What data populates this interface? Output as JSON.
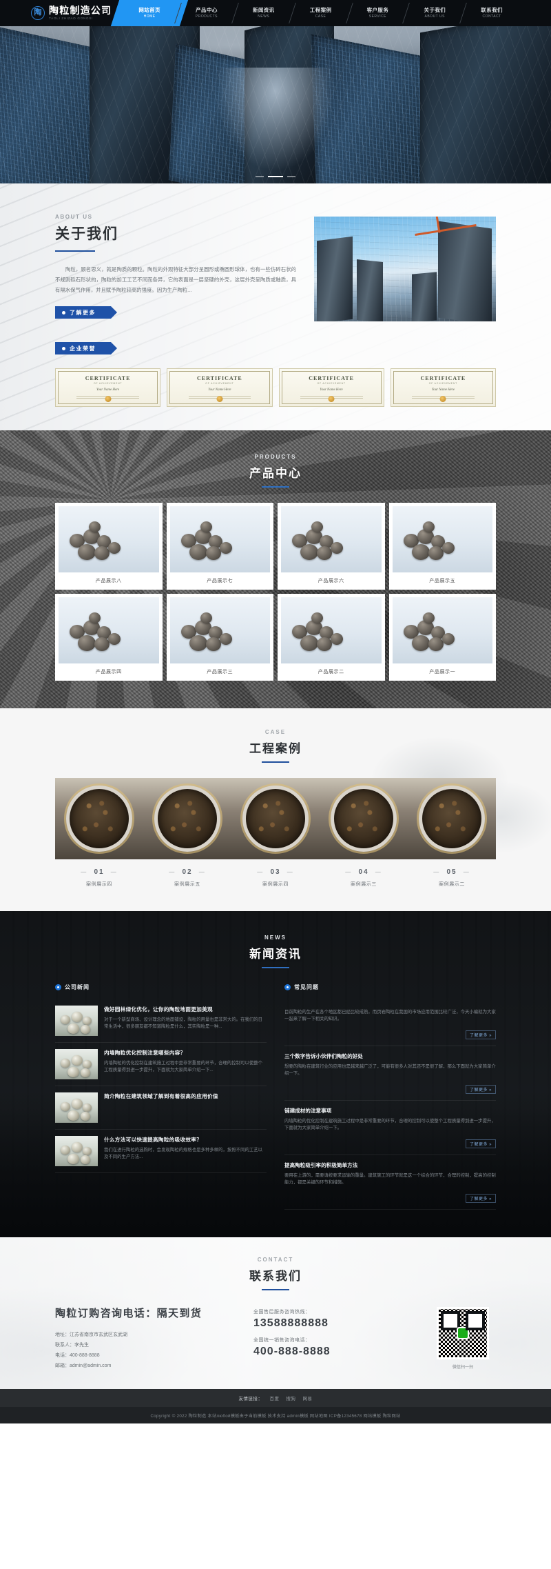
{
  "site": {
    "logo_char": "陶",
    "name_cn": "陶粒制造公司",
    "name_en": "TAOLI ZHIZAO GONGSI"
  },
  "nav": [
    {
      "cn": "网站首页",
      "en": "HOME",
      "active": true
    },
    {
      "cn": "产品中心",
      "en": "PRODUCTS",
      "active": false
    },
    {
      "cn": "新闻资讯",
      "en": "NEWS",
      "active": false
    },
    {
      "cn": "工程案例",
      "en": "CASE",
      "active": false
    },
    {
      "cn": "客户服务",
      "en": "SERVICE",
      "active": false
    },
    {
      "cn": "关于我们",
      "en": "ABOUT US",
      "active": false
    },
    {
      "cn": "联系我们",
      "en": "CONTACT",
      "active": false
    }
  ],
  "hero": {
    "slides": 3,
    "active_slide": 1
  },
  "about": {
    "eyebrow": "ABOUT US",
    "title": "关于我们",
    "paragraph": "陶粒，顾名思义，就是陶质的颗粒。陶粒的外观特征大部分呈圆形或椭圆形球体，也有一些仿碎石状的不规则砾石形状的，陶粒的加工工艺不同而各异，它的表面是一层坚硬的外壳，这层外壳呈陶质或釉质，具有隔水保气作用，并且赋予陶粒较高的强度。因为生产陶粒...",
    "more_button": "了解更多",
    "honor_label": "企业荣誉",
    "certificates": [
      {
        "title": "CERTIFICATE",
        "subtitle": "OF ACHIEVEMENT",
        "name": "Your Name Here"
      },
      {
        "title": "CERTIFICATE",
        "subtitle": "OF ACHIEVEMENT",
        "name": "Your Name Here"
      },
      {
        "title": "CERTIFICATE",
        "subtitle": "OF ACHIEVEMENT",
        "name": "Your Name Here"
      },
      {
        "title": "CERTIFICATE",
        "subtitle": "OF ACHIEVEMENT",
        "name": "Your Name Here"
      }
    ]
  },
  "products": {
    "eyebrow": "PRODUCTS",
    "title": "产品中心",
    "items": [
      {
        "caption": "产品展示八"
      },
      {
        "caption": "产品展示七"
      },
      {
        "caption": "产品展示六"
      },
      {
        "caption": "产品展示五"
      },
      {
        "caption": "产品展示四"
      },
      {
        "caption": "产品展示三"
      },
      {
        "caption": "产品展示二"
      },
      {
        "caption": "产品展示一"
      }
    ]
  },
  "cases": {
    "eyebrow": "CASE",
    "title": "工程案例",
    "items": [
      {
        "no": "01",
        "name": "案例展示四"
      },
      {
        "no": "02",
        "name": "案例展示五"
      },
      {
        "no": "03",
        "name": "案例展示四"
      },
      {
        "no": "04",
        "name": "案例展示三"
      },
      {
        "no": "05",
        "name": "案例展示二"
      }
    ]
  },
  "news": {
    "eyebrow": "NEWS",
    "title": "新闻资讯",
    "left_tab": "公司新闻",
    "right_tab": "常见问题",
    "more_label": "了解更多 »",
    "left_items": [
      {
        "title": "做好园林绿化优化，让你的陶粒地面更加美观",
        "desc": "对于一个新型商场、设计理念的地面铺设，陶粒的用量也是非常大的。在我们的日常生活中，很多朋友都不知道陶粒是什么，其实陶粒是一种..."
      },
      {
        "title": "内墙陶粒优化控制注意哪些内容？",
        "desc": "内墙陶粒的优化控制在建筑施工过程中是非常重要的环节，合理的控制可以使整个工程质量得到进一步提升，下面就为大家简单介绍一下..."
      },
      {
        "title": "简介陶粒在建筑领域了解到有着很高的应用价值"
      },
      {
        "title": "什么方法可以快速提高陶粒的吸收效率？",
        "desc": "我们在进行陶粒的选购时，会发现陶粒的规格也是多种多样的，按照不同的工艺以及不同的生产方法..."
      }
    ],
    "right_items": [
      {
        "title": "目前陶粒的生产在各个地区都已经比较成熟，而页岩陶粒在我国的市场应用范围比较广泛",
        "desc": "目前陶粒的生产在各个地区都已经比较成熟，而页岩陶粒在我国的市场应用范围比较广泛，今天小编就为大家一起来了解一下相关的知识。"
      },
      {
        "title": "三个数字告诉小伙伴们陶粒的好处",
        "desc": "想要的陶粒在建筑行业的应用也是越来越广泛了，可能有很多人对其还不是很了解，那么下面就为大家简单介绍一下。"
      },
      {
        "title": "铺建成材的注意事项",
        "desc": "内墙陶粒的优化控制在建筑施工过程中是非常重要的环节，合理的控制可以使整个工程质量得到进一步提升，下面就为大家简单介绍一下。"
      },
      {
        "title": "提高陶粒吸引率的积极简单方法",
        "desc": "要用在上游的，需要请按要求运输的重量。建筑施工的环节就是这一个综合的环节，合理的控制，提高的控制能力，都是关键的环节和措施。"
      }
    ]
  },
  "contact": {
    "eyebrow": "CONTACT",
    "title": "联系我们",
    "slogan": "陶粒订购咨询电话：隔天到货",
    "details": [
      "地址：江苏省南京市玄武区玄武湖",
      "联系人：李先生",
      "电话：400-888-8888",
      "邮箱：admin@admin.com"
    ],
    "phone_label_1": "全国售后服务咨询热线：",
    "phone_1": "13588888888",
    "phone_label_2": "全国统一销售咨询电话：",
    "phone_2": "400-888-8888",
    "qr_caption": "微信扫一扫"
  },
  "footer": {
    "links_label": "友情链接：",
    "links": [
      "百度",
      "搜狗",
      "网易"
    ],
    "copyright": "Copyright © 2022 陶粒制造 本站любой模板由于当前模板 技术支持 admin模板 网站地图 ICP备12345678 网站模板 陶粒网站"
  }
}
